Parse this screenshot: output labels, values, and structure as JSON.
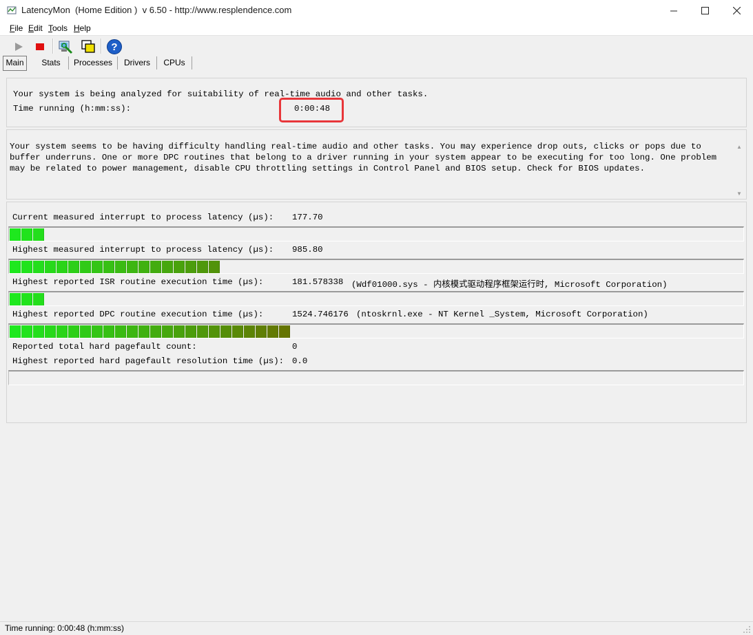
{
  "window": {
    "title": "LatencyMon  (Home Edition )  v 6.50 - http://www.resplendence.com"
  },
  "menu": [
    "File",
    "Edit",
    "Tools",
    "Help"
  ],
  "toolbar": {
    "icons": [
      "play-icon",
      "stop-icon",
      "system-info-icon",
      "windows-icon",
      "help-icon"
    ],
    "colors": {
      "stop": "#e01010",
      "help": "#1e5fc8"
    }
  },
  "tabs": [
    "Main",
    "Stats",
    "Processes",
    "Drivers",
    "CPUs"
  ],
  "status": {
    "line1": "Your system is being analyzed for suitability of real-time audio and other tasks.",
    "time_label": "Time running (h:mm:ss):",
    "time_value": "0:00:48"
  },
  "description": "Your system seems to be having difficulty handling real-time audio and other tasks. You may experience drop outs, clicks or pops due to buffer underruns. One or more DPC routines that belong to a driver running in your system appear to be executing for too long. One problem may be related to power management, disable CPU throttling settings in Control Panel and BIOS setup. Check for BIOS updates.",
  "metrics": [
    {
      "label": "Current measured interrupt to process latency (µs):",
      "value": "177.70",
      "detail": "",
      "segments": 3
    },
    {
      "label": "Highest measured interrupt to process latency (µs):",
      "value": "985.80",
      "detail": "",
      "segments": 18
    },
    {
      "label": "Highest reported ISR routine execution time (µs):",
      "value": "181.578338",
      "detail": "(Wdf01000.sys - 内核模式驱动程序框架运行时, Microsoft Corporation)",
      "segments": 3
    },
    {
      "label": "Highest reported DPC routine execution time (µs):",
      "value": "1524.746176",
      "detail": "(ntoskrnl.exe - NT Kernel _System, Microsoft Corporation)",
      "segments": 24
    }
  ],
  "pagefault": {
    "count_label": "Reported total hard pagefault count:",
    "count_value": "0",
    "time_label": "Highest reported hard pagefault resolution time (µs):",
    "time_value": "0.0",
    "segments": 0
  },
  "statusbar": {
    "text": "Time running: 0:00:48  (h:mm:ss)"
  },
  "colors": {
    "bar_start": "#1ee81e",
    "bar_end": "#6b6b00",
    "highlight": "#e8363a"
  }
}
